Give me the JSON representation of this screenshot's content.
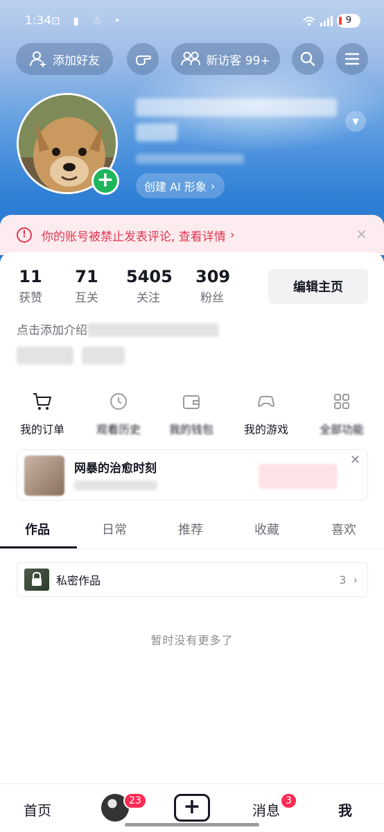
{
  "status_bar": {
    "time": "1:34",
    "battery": "9"
  },
  "header": {
    "add_friend": "添加好友",
    "visitors": "新访客 99+",
    "create_ai": "创建 AI 形象"
  },
  "ban_notice": {
    "text": "你的账号被禁止发表评论, 查看详情"
  },
  "stats": [
    {
      "value": "11",
      "label": "获赞"
    },
    {
      "value": "71",
      "label": "互关"
    },
    {
      "value": "5405",
      "label": "关注"
    },
    {
      "value": "309",
      "label": "粉丝"
    }
  ],
  "edit_profile": "编辑主页",
  "bio_prefix": "点击添加介绍",
  "tools": [
    {
      "label": "我的订单",
      "icon": "cart-icon"
    },
    {
      "label": "观看历史",
      "icon": "history-icon"
    },
    {
      "label": "我的钱包",
      "icon": "wallet-icon"
    },
    {
      "label": "我的游戏",
      "icon": "game-icon"
    },
    {
      "label": "全部功能",
      "icon": "apps-icon"
    }
  ],
  "promo_card": {
    "title": "网暴的治愈时刻"
  },
  "tabs": [
    "作品",
    "日常",
    "推荐",
    "收藏",
    "喜欢"
  ],
  "private_works": {
    "label": "私密作品",
    "count": "3"
  },
  "empty_text": "暂时没有更多了",
  "bottom_nav": {
    "home": "首页",
    "friends_badge": "23",
    "messages": "消息",
    "messages_badge": "3",
    "me": "我"
  },
  "colors": {
    "accent": "#fe2c55",
    "ban_red": "#e1344f",
    "plus_green": "#1fb65b"
  }
}
